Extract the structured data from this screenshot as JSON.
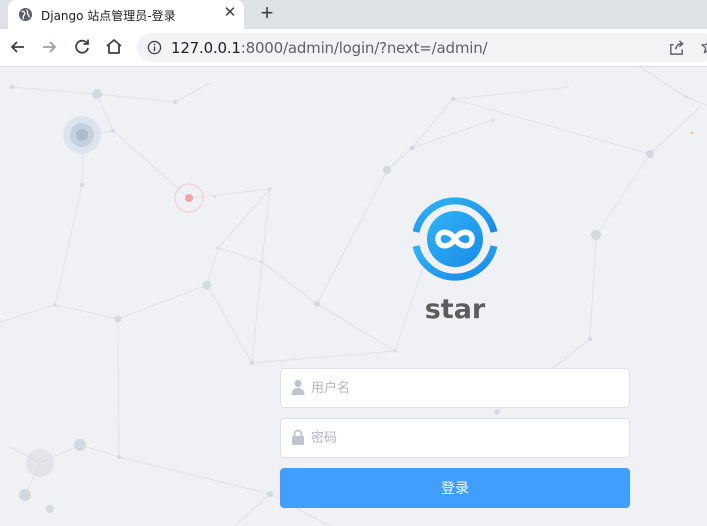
{
  "tab": {
    "title": "Django 站点管理员-登录",
    "icon": "globe-icon",
    "close_label": "✕"
  },
  "new_tab_label": "+",
  "toolbar": {
    "back_icon": "arrow-left-icon",
    "forward_icon": "arrow-right-icon",
    "reload_icon": "reload-icon",
    "home_icon": "home-icon"
  },
  "address": {
    "host": "127.0.0.1",
    "rest": ":8000/admin/login/?next=/admin/",
    "info_icon": "info-icon",
    "share_icon": "share-icon",
    "bookmark_icon": "star-icon"
  },
  "login": {
    "brand": "star",
    "logo_icon": "infinity-logo-icon",
    "username_placeholder": "用户名",
    "password_placeholder": "密码",
    "submit_label": "登录"
  },
  "colors": {
    "accent": "#409eff",
    "logo_blue": "#1f9bf0",
    "brand_text": "#5d5d5d",
    "page_bg": "#f0f1f5",
    "decor_red": "#f06a6a"
  }
}
